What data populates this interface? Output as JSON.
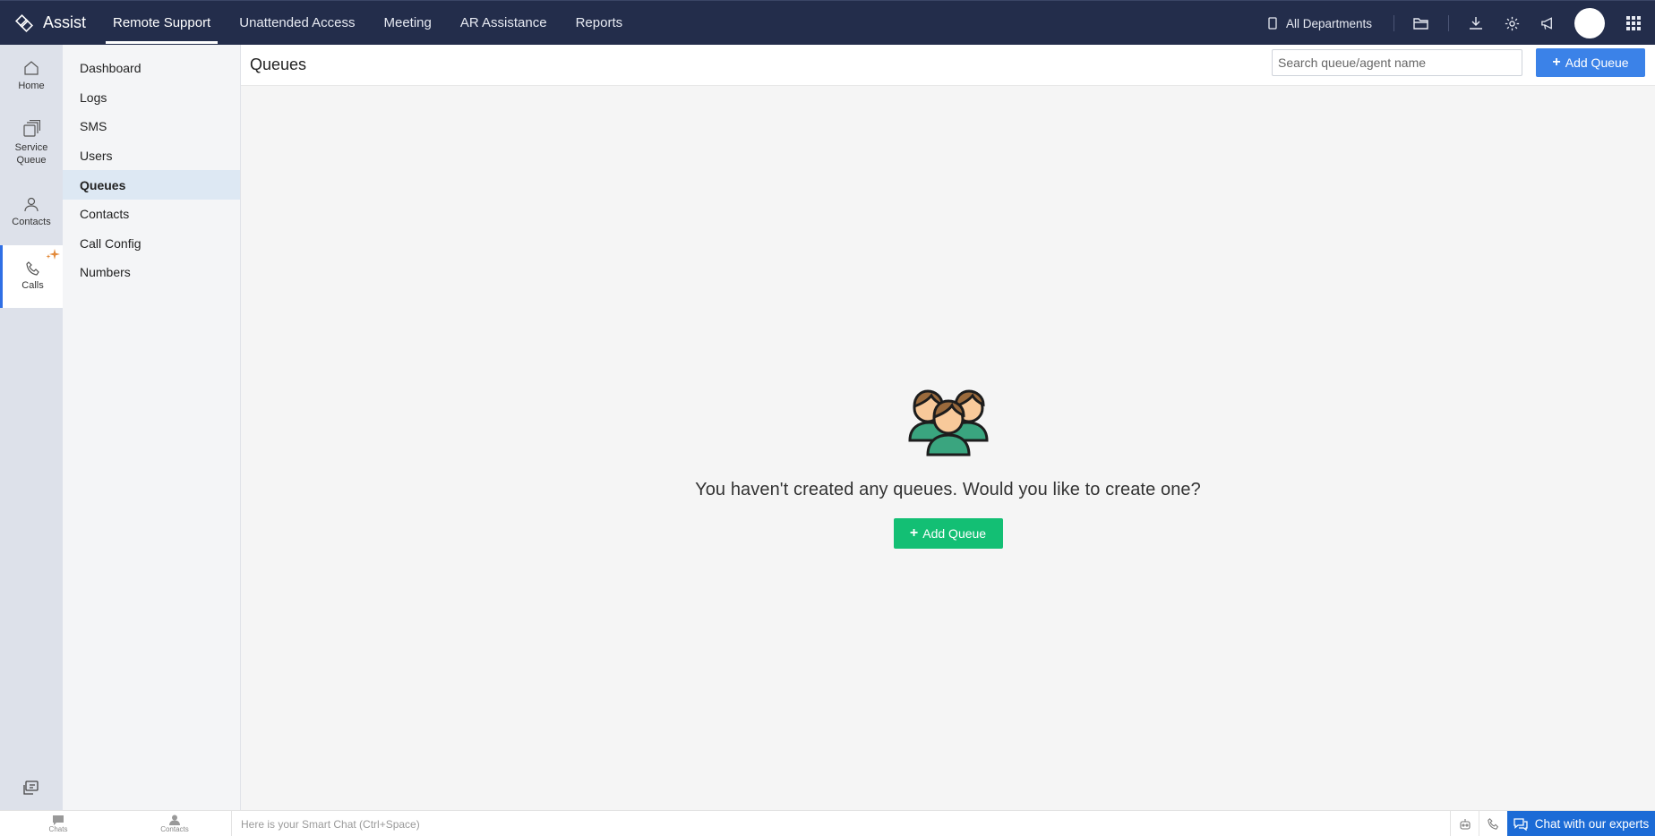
{
  "brand": {
    "name": "Assist"
  },
  "topnav": [
    {
      "label": "Remote Support",
      "active": true
    },
    {
      "label": "Unattended Access"
    },
    {
      "label": "Meeting"
    },
    {
      "label": "AR Assistance"
    },
    {
      "label": "Reports"
    }
  ],
  "header": {
    "department": "All Departments",
    "icons": [
      "folder-icon",
      "download-icon",
      "gear-icon",
      "megaphone-icon",
      "avatar",
      "app-grid-icon"
    ]
  },
  "rail": {
    "items": [
      {
        "label": "Home",
        "icon": "home-icon"
      },
      {
        "label": "Service Queue",
        "line1": "Service",
        "line2": "Queue",
        "icon": "service-queue-icon"
      },
      {
        "label": "Contacts",
        "icon": "contact-icon"
      },
      {
        "label": "Calls",
        "icon": "phone-icon",
        "active": true
      }
    ]
  },
  "subnav": {
    "items": [
      {
        "label": "Dashboard"
      },
      {
        "label": "Logs"
      },
      {
        "label": "SMS"
      },
      {
        "label": "Users"
      },
      {
        "label": "Queues",
        "active": true
      },
      {
        "label": "Contacts"
      },
      {
        "label": "Call Config"
      },
      {
        "label": "Numbers"
      }
    ]
  },
  "main": {
    "title": "Queues",
    "search_placeholder": "Search queue/agent name",
    "add_label": "Add Queue",
    "empty_text": "You haven't created any queues. Would you like to create one?",
    "empty_button": "Add Queue"
  },
  "bottombar": {
    "tabs": [
      {
        "label": "Chats",
        "icon": "chat-bubble-icon"
      },
      {
        "label": "Contacts",
        "icon": "contact-icon"
      }
    ],
    "smartchat_placeholder": "Here is your Smart Chat (Ctrl+Space)",
    "chat_experts": "Chat with our experts"
  },
  "colors": {
    "topbar": "#232d4b",
    "accent_blue": "#3b82e8",
    "accent_green": "#13bf74",
    "chat_blue": "#1c6bd6"
  }
}
